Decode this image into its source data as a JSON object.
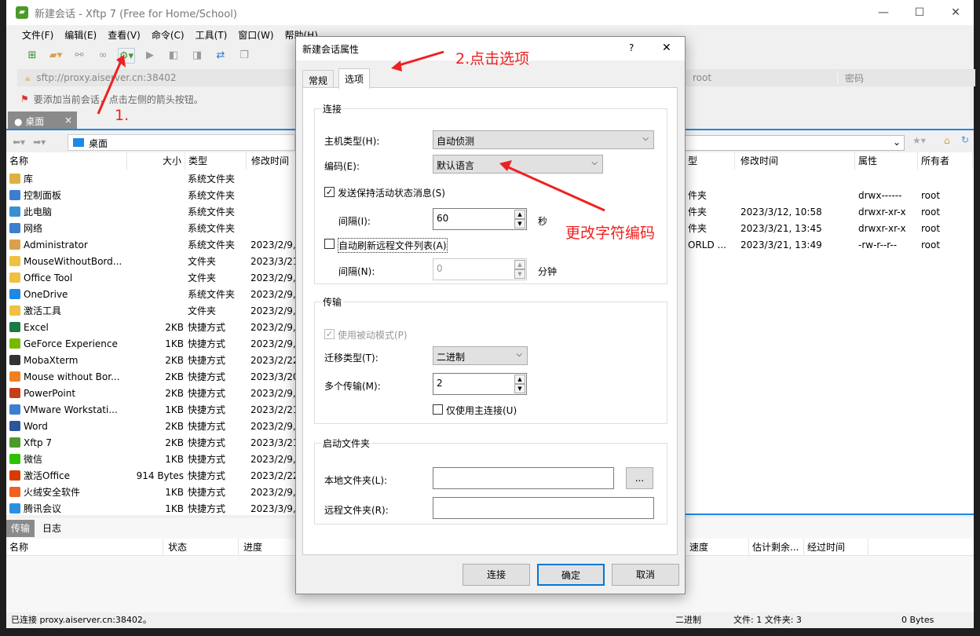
{
  "window": {
    "title": "新建会话 - Xftp 7 (Free for Home/School)",
    "minimize": "—",
    "maximize": "☐",
    "close": "✕"
  },
  "menu": [
    "文件(F)",
    "编辑(E)",
    "查看(V)",
    "命令(C)",
    "工具(T)",
    "窗口(W)",
    "帮助(H)"
  ],
  "address": {
    "url": "sftp://proxy.aiserver.cn:38402",
    "user": "root",
    "password_placeholder": "密码"
  },
  "hint": "要添加当前会话，点击左侧的箭头按钮。",
  "tabs": {
    "local": "桌面",
    "close": "×"
  },
  "local": {
    "path": "桌面",
    "columns": [
      "名称",
      "大小",
      "类型",
      "修改时间"
    ],
    "rows": [
      [
        "库",
        "",
        "系统文件夹",
        ""
      ],
      [
        "控制面板",
        "",
        "系统文件夹",
        ""
      ],
      [
        "此电脑",
        "",
        "系统文件夹",
        ""
      ],
      [
        "网络",
        "",
        "系统文件夹",
        ""
      ],
      [
        "Administrator",
        "",
        "系统文件夹",
        "2023/2/9,"
      ],
      [
        "MouseWithoutBord...",
        "",
        "文件夹",
        "2023/3/21"
      ],
      [
        "Office Tool",
        "",
        "文件夹",
        "2023/2/9,"
      ],
      [
        "OneDrive",
        "",
        "系统文件夹",
        "2023/2/9,"
      ],
      [
        "激活工具",
        "",
        "文件夹",
        "2023/2/9,"
      ],
      [
        "Excel",
        "2KB",
        "快捷方式",
        "2023/2/9,"
      ],
      [
        "GeForce Experience",
        "1KB",
        "快捷方式",
        "2023/2/9,"
      ],
      [
        "MobaXterm",
        "2KB",
        "快捷方式",
        "2023/2/22"
      ],
      [
        "Mouse without Bor...",
        "2KB",
        "快捷方式",
        "2023/3/20"
      ],
      [
        "PowerPoint",
        "2KB",
        "快捷方式",
        "2023/2/9,"
      ],
      [
        "VMware Workstati...",
        "1KB",
        "快捷方式",
        "2023/2/21"
      ],
      [
        "Word",
        "2KB",
        "快捷方式",
        "2023/2/9,"
      ],
      [
        "Xftp 7",
        "2KB",
        "快捷方式",
        "2023/3/21"
      ],
      [
        "微信",
        "1KB",
        "快捷方式",
        "2023/2/9,"
      ],
      [
        "激活Office",
        "914 Bytes",
        "快捷方式",
        "2023/2/22"
      ],
      [
        "火绒安全软件",
        "1KB",
        "快捷方式",
        "2023/2/9,"
      ],
      [
        "腾讯会议",
        "1KB",
        "快捷方式",
        "2023/3/9,"
      ]
    ]
  },
  "remote": {
    "columns": [
      "型",
      "修改时间",
      "属性",
      "所有者"
    ],
    "rows": [
      [
        "",
        "",
        "",
        ""
      ],
      [
        "件夹",
        "",
        "drwx------",
        "root"
      ],
      [
        "件夹",
        "2023/3/12, 10:58",
        "drwxr-xr-x",
        "root"
      ],
      [
        "件夹",
        "2023/3/21, 13:45",
        "drwxr-xr-x",
        "root"
      ],
      [
        "ORLD ...",
        "2023/3/21, 13:49",
        "-rw-r--r--",
        "root"
      ]
    ]
  },
  "transfer": {
    "tabs": [
      "传输",
      "日志"
    ],
    "columns": [
      "名称",
      "状态",
      "进度",
      "速度",
      "估计剩余...",
      "经过时间"
    ]
  },
  "status": {
    "connected": "已连接 proxy.aiserver.cn:38402。",
    "mode": "二进制",
    "counts": "文件: 1  文件夹: 3",
    "size": "0 Bytes"
  },
  "dialog": {
    "title": "新建会话属性",
    "help": "?",
    "close": "✕",
    "tabs": [
      "常规",
      "选项"
    ],
    "connection": {
      "legend": "连接",
      "host_type_label": "主机类型(H):",
      "host_type": "自动侦测",
      "encoding_label": "编码(E):",
      "encoding": "默认语言",
      "keepalive_label": "发送保持活动状态消息(S)",
      "keepalive_checked": true,
      "interval_label": "间隔(I):",
      "interval": "60",
      "interval_unit": "秒",
      "refresh_label": "自动刷新远程文件列表(A)",
      "refresh_checked": false,
      "refresh_interval_label": "间隔(N):",
      "refresh_interval": "0",
      "refresh_unit": "分钟"
    },
    "transfer": {
      "legend": "传输",
      "passive_label": "使用被动模式(P)",
      "passive_checked": true,
      "type_label": "迁移类型(T):",
      "type": "二进制",
      "multi_label": "多个传输(M):",
      "multi": "2",
      "main_only_label": "仅使用主连接(U)",
      "main_only_checked": false
    },
    "startup": {
      "legend": "启动文件夹",
      "local_label": "本地文件夹(L):",
      "local": "",
      "browse": "...",
      "remote_label": "远程文件夹(R):",
      "remote": ""
    },
    "buttons": {
      "connect": "连接",
      "ok": "确定",
      "cancel": "取消"
    }
  },
  "annotations": {
    "step1": "1.",
    "step2": "2.点击选项",
    "encoding_note": "更改字符编码",
    "color": "#f02020"
  }
}
